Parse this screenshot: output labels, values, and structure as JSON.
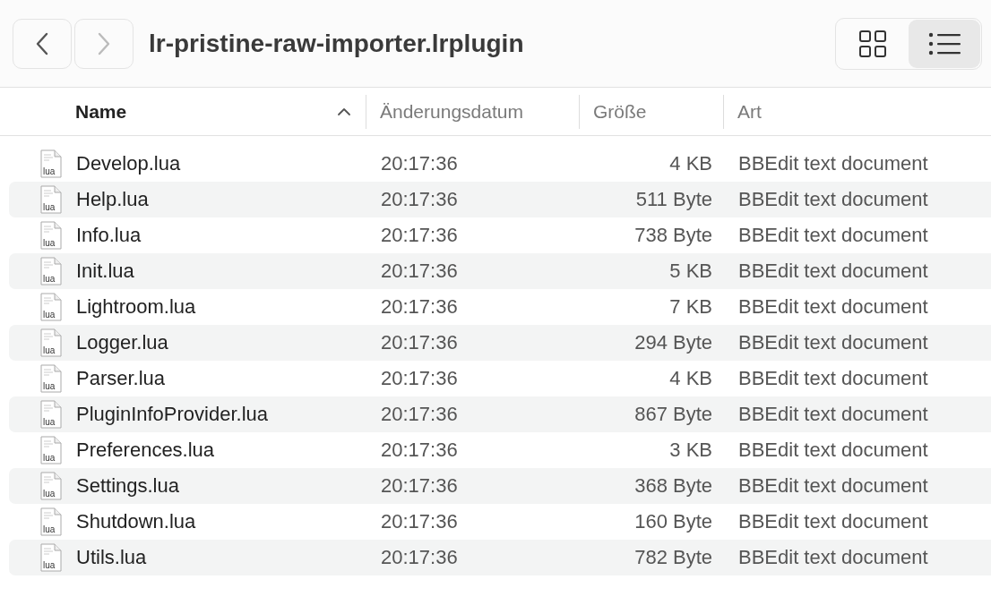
{
  "toolbar": {
    "back": {
      "disabled": false
    },
    "forward": {
      "disabled": true
    },
    "title": "lr-pristine-raw-importer.lrplugin",
    "views": [
      {
        "kind": "grid",
        "selected": false
      },
      {
        "kind": "list",
        "selected": true
      }
    ]
  },
  "table": {
    "columns": [
      {
        "label": "Name",
        "sorted": true
      },
      {
        "label": "Änderungsdatum",
        "sorted": false
      },
      {
        "label": "Größe",
        "sorted": false
      },
      {
        "label": "Art",
        "sorted": false
      }
    ],
    "rows": [
      {
        "icon_text": "lua",
        "name": "Develop.lua",
        "date": "20:17:36",
        "size": "4 KB",
        "kind": "BBEdit text document"
      },
      {
        "icon_text": "lua",
        "name": "Help.lua",
        "date": "20:17:36",
        "size": "511 Byte",
        "kind": "BBEdit text document"
      },
      {
        "icon_text": "lua",
        "name": "Info.lua",
        "date": "20:17:36",
        "size": "738 Byte",
        "kind": "BBEdit text document"
      },
      {
        "icon_text": "lua",
        "name": "Init.lua",
        "date": "20:17:36",
        "size": "5 KB",
        "kind": "BBEdit text document"
      },
      {
        "icon_text": "lua",
        "name": "Lightroom.lua",
        "date": "20:17:36",
        "size": "7 KB",
        "kind": "BBEdit text document"
      },
      {
        "icon_text": "lua",
        "name": "Logger.lua",
        "date": "20:17:36",
        "size": "294 Byte",
        "kind": "BBEdit text document"
      },
      {
        "icon_text": "lua",
        "name": "Parser.lua",
        "date": "20:17:36",
        "size": "4 KB",
        "kind": "BBEdit text document"
      },
      {
        "icon_text": "lua",
        "name": "PluginInfoProvider.lua",
        "date": "20:17:36",
        "size": "867 Byte",
        "kind": "BBEdit text document"
      },
      {
        "icon_text": "lua",
        "name": "Preferences.lua",
        "date": "20:17:36",
        "size": "3 KB",
        "kind": "BBEdit text document"
      },
      {
        "icon_text": "lua",
        "name": "Settings.lua",
        "date": "20:17:36",
        "size": "368 Byte",
        "kind": "BBEdit text document"
      },
      {
        "icon_text": "lua",
        "name": "Shutdown.lua",
        "date": "20:17:36",
        "size": "160 Byte",
        "kind": "BBEdit text document"
      },
      {
        "icon_text": "lua",
        "name": "Utils.lua",
        "date": "20:17:36",
        "size": "782 Byte",
        "kind": "BBEdit text document"
      }
    ]
  }
}
